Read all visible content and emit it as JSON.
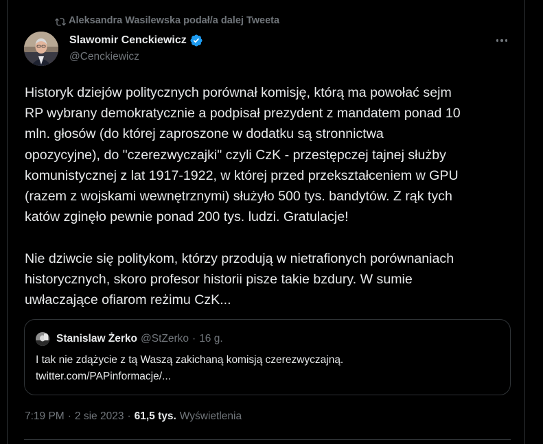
{
  "retweet": {
    "text": "Aleksandra Wasilewska podał/a dalej Tweeta",
    "icon": "retweet-icon"
  },
  "author": {
    "name": "Slawomir Cenckiewicz",
    "handle": "@Cenckiewicz",
    "verified": true,
    "verified_color": "#1d9bf0"
  },
  "tweet": {
    "lines": [
      "Historyk dziejów politycznych porównał komisję, którą ma powołać sejm",
      "RP wybrany demokratycznie a podpisał prezydent z mandatem ponad 10",
      "mln. głosów (do której zaproszone w dodatku są stronnictwa",
      "opozycyjne), do \"czerezwyczajki\" czyli CzK - przestępczej tajnej służby",
      "komunistycznej z lat 1917-1922, w której przed przekształceniem w GPU",
      "(razem z wojskami wewnętrznymi) służyło 500 tys. bandytów. Z rąk tych",
      "katów zginęło pewnie ponad 200 tys. ludzi. Gratulacje!",
      "",
      "Nie dziwcie się politykom, którzy przodują w nietrafionych porównaniach",
      "historycznych, skoro profesor historii pisze takie bzdury. W sumie",
      "uwłaczające ofiarom reżimu CzK..."
    ]
  },
  "quote": {
    "name": "Stanislaw Żerko",
    "handle": "@StZerko",
    "separator": "·",
    "time": "16 g.",
    "lines": [
      "I tak nie zdążycie z tą Waszą zakichaną komisją czerezwyczajną.",
      "twitter.com/PAPinformacje/..."
    ]
  },
  "meta": {
    "time": "7:19 PM",
    "sep1": "·",
    "date": "2 sie 2023",
    "sep2": "·",
    "views_count": "61,5 tys.",
    "views_label": "Wyświetlenia"
  },
  "colors": {
    "background": "#000000",
    "text": "#e7e9ea",
    "muted": "#71767b",
    "border": "#2f3336",
    "accent": "#1d9bf0"
  }
}
